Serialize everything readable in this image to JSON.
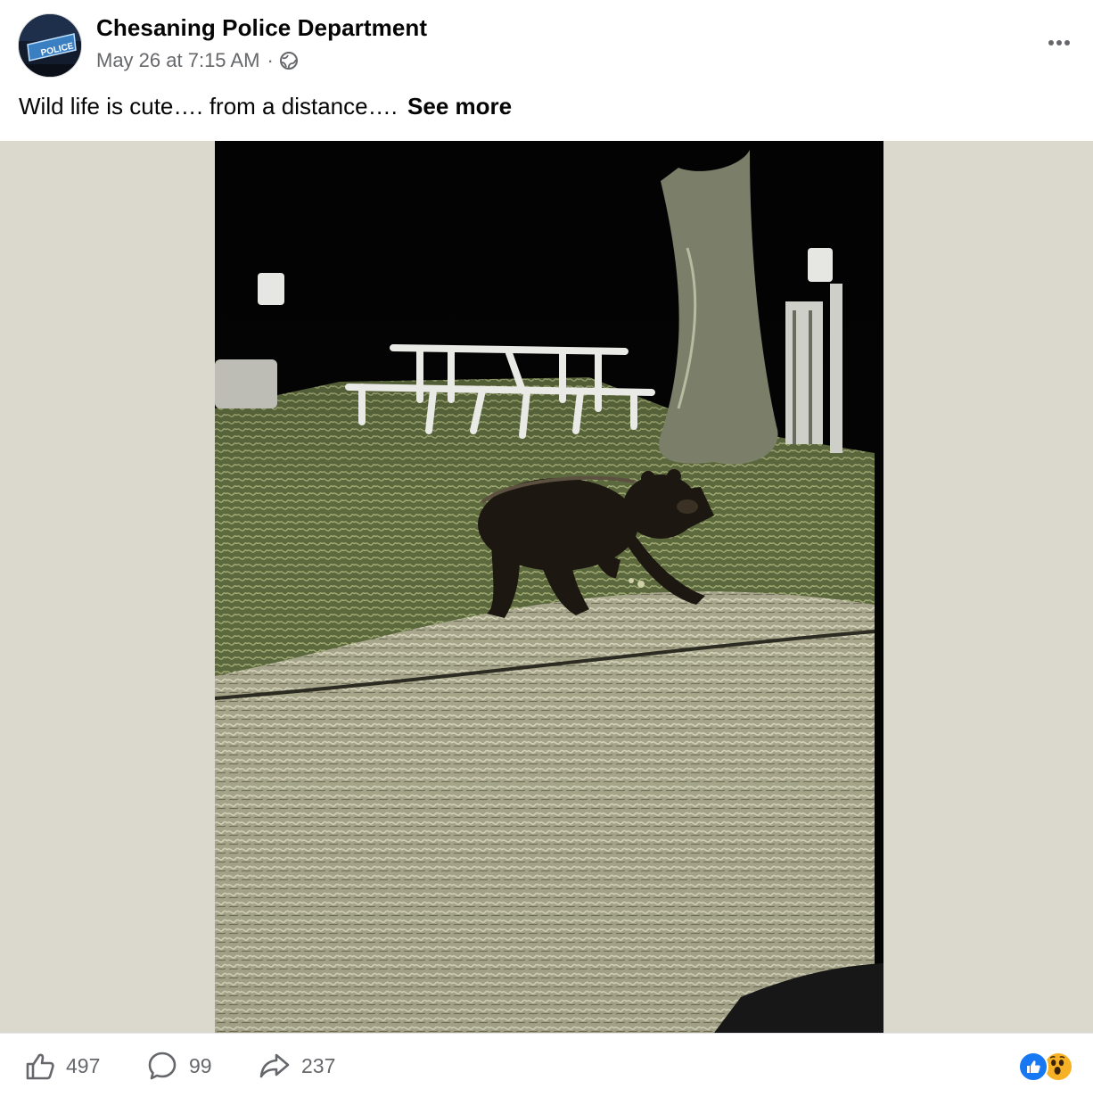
{
  "post": {
    "author": "Chesaning Police Department",
    "timestamp": "May 26 at 7:15 AM",
    "separator": "·",
    "privacy_icon": "globe-icon",
    "more_icon": "more-options-icon",
    "caption": "Wild life is cute…. from a distance….",
    "see_more_label": "See more",
    "avatar_badge_text": "POLICE",
    "photo_description_icon": "night-photo-black-bear"
  },
  "engagement": {
    "likes": "497",
    "comments": "99",
    "shares": "237",
    "reactions": [
      "like-reaction-icon",
      "wow-reaction-icon"
    ]
  },
  "colors": {
    "text_primary": "#050505",
    "text_secondary": "#65676b",
    "media_background": "#dbd9cd",
    "like_blue": "#1877f2",
    "wow_yellow": "#f7b125"
  }
}
